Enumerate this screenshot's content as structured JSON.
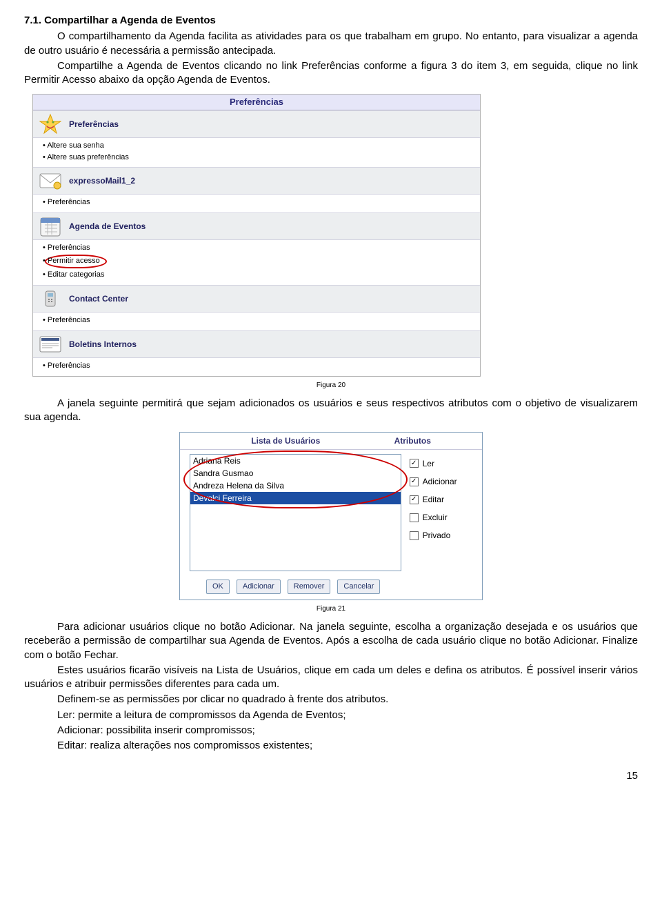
{
  "doc": {
    "heading": "7.1. Compartilhar a Agenda de Eventos",
    "p1": "O compartilhamento da Agenda facilita as atividades para os que trabalham em grupo. No entanto, para visualizar a agenda de outro usuário é necessária a permissão antecipada.",
    "p2": "Compartilhe a Agenda de Eventos clicando no link Preferências conforme a figura 3 do item 3, em seguida, clique no link Permitir Acesso abaixo da opção Agenda de Eventos.",
    "p3": "A janela seguinte permitirá que sejam adicionados os usuários e seus respectivos atributos com o objetivo de visualizarem sua agenda.",
    "p4": "Para adicionar usuários clique no botão Adicionar. Na janela seguinte, escolha a organização desejada e os usuários que receberão a permissão de compartilhar sua Agenda de Eventos. Após a escolha de cada usuário clique no botão Adicionar. Finalize com o botão Fechar.",
    "p5": "Estes usuários ficarão visíveis na Lista de Usuários, clique em cada um deles e defina os atributos. É possível inserir vários usuários e atribuir permissões diferentes para cada um.",
    "p6": "Definem-se as permissões por clicar no quadrado à frente dos atributos.",
    "p7": "Ler: permite a leitura de compromissos da Agenda de Eventos;",
    "p8": "Adicionar: possibilita inserir compromissos;",
    "p9": "Editar: realiza alterações nos compromissos existentes;",
    "fig20": "Figura 20",
    "fig21": "Figura 21",
    "page": "15"
  },
  "prefs": {
    "title": "Preferências",
    "sections": [
      {
        "name": "Preferências",
        "links": [
          "Altere sua senha",
          "Altere suas preferências"
        ]
      },
      {
        "name": "expressoMail1_2",
        "links": [
          "Preferências"
        ]
      },
      {
        "name": "Agenda de Eventos",
        "links": [
          "Preferências",
          "Permitir acesso",
          "Editar categorias"
        ],
        "circledIndex": 1
      },
      {
        "name": "Contact Center",
        "links": [
          "Preferências"
        ]
      },
      {
        "name": "Boletins Internos",
        "links": [
          "Preferências"
        ]
      }
    ]
  },
  "userpanel": {
    "col_users": "Lista de Usuários",
    "col_attrs": "Atributos",
    "users": [
      "Adriana Reis",
      "Sandra Gusmao",
      "Andreza Helena da Silva",
      "Devalci Ferreira"
    ],
    "selectedIndex": 3,
    "attrs": [
      {
        "label": "Ler",
        "checked": true
      },
      {
        "label": "Adicionar",
        "checked": true
      },
      {
        "label": "Editar",
        "checked": true
      },
      {
        "label": "Excluir",
        "checked": false
      },
      {
        "label": "Privado",
        "checked": false
      }
    ],
    "buttons": [
      "OK",
      "Adicionar",
      "Remover",
      "Cancelar"
    ]
  }
}
